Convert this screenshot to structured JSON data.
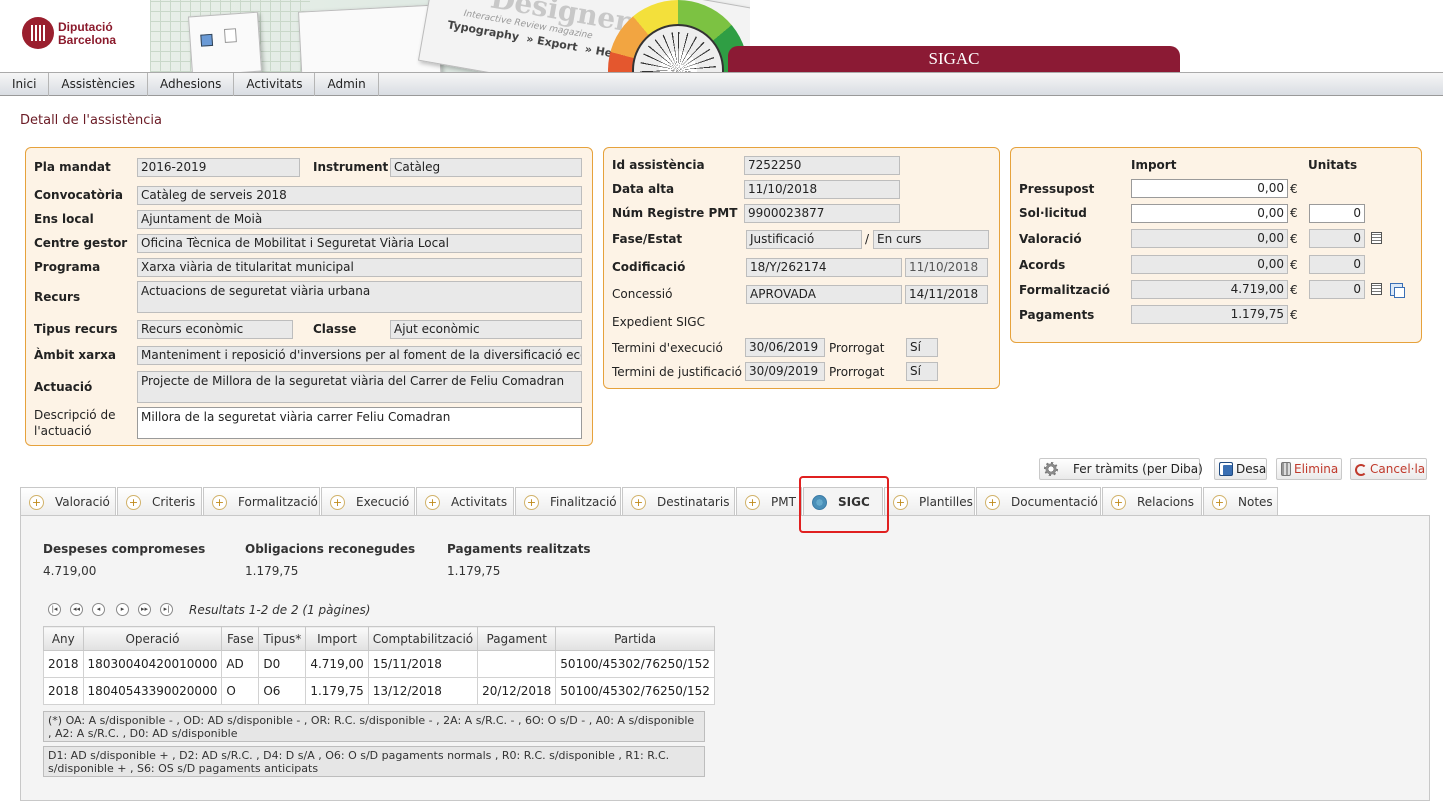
{
  "header": {
    "logo_line1": "Diputació",
    "logo_line2": "Barcelona",
    "banner_word": "Designer",
    "banner_sub": "Interactive Review magazine",
    "banner_menu": [
      "Typography",
      "» Export",
      "» Help"
    ],
    "app_title": "SIGAC"
  },
  "menu": [
    "Inici",
    "Assistències",
    "Adhesions",
    "Activitats",
    "Admin"
  ],
  "page_title": "Detall de l'assistència",
  "left_panel": {
    "pla_mandat_label": "Pla mandat",
    "pla_mandat": "2016-2019",
    "instrument_label": "Instrument",
    "instrument": "Catàleg",
    "convocatoria_label": "Convocatòria",
    "convocatoria": "Catàleg de serveis 2018",
    "ens_local_label": "Ens local",
    "ens_local": "Ajuntament de Moià",
    "centre_gestor_label": "Centre gestor",
    "centre_gestor": "Oficina Tècnica de Mobilitat i Seguretat Viària Local",
    "programa_label": "Programa",
    "programa": "Xarxa viària de titularitat municipal",
    "recurs_label": "Recurs",
    "recurs": "Actuacions de seguretat viària urbana",
    "tipus_recurs_label": "Tipus recurs",
    "tipus_recurs": "Recurs econòmic",
    "classe_label": "Classe",
    "classe": "Ajut econòmic",
    "ambit_label": "Àmbit xarxa",
    "ambit": "Manteniment i reposició d'inversions per al foment de la diversificació econòmica",
    "actuacio_label": "Actuació",
    "actuacio": "Projecte de Millora de la seguretat viària del Carrer de Feliu Comadran",
    "descripcio_label1": "Descripció de",
    "descripcio_label2": "l'actuació",
    "descripcio": "Millora de la seguretat viària carrer Feliu Comadran"
  },
  "mid_panel": {
    "id_label": "Id assistència",
    "id": "7252250",
    "data_alta_label": "Data alta",
    "data_alta": "11/10/2018",
    "num_registre_label": "Núm Registre PMT",
    "num_registre": "9900023877",
    "fase_label": "Fase/Estat",
    "fase": "Justificació",
    "fase_sep": "/",
    "estat": "En curs",
    "codificacio_label": "Codificació",
    "codificacio": "18/Y/262174",
    "codificacio_date": "11/10/2018",
    "concessio_label": "Concessió",
    "concessio": "APROVADA",
    "concessio_date": "14/11/2018",
    "expedient_label": "Expedient SIGC",
    "termini_exec_label": "Termini d'execució",
    "termini_exec": "30/06/2019",
    "termini_just_label": "Termini de justificació",
    "termini_just": "30/09/2019",
    "prorrogat_label": "Prorrogat",
    "prorrogat1": "Sí",
    "prorrogat2": "Sí"
  },
  "right_panel": {
    "import_header": "Import",
    "unitats_header": "Unitats",
    "currency": "€",
    "rows": [
      {
        "label": "Pressupost",
        "import": "0,00",
        "unitats": null
      },
      {
        "label": "Sol·licitud",
        "import": "0,00",
        "unitats": "0"
      },
      {
        "label": "Valoració",
        "import": "0,00",
        "unitats": "0"
      },
      {
        "label": "Acords",
        "import": "0,00",
        "unitats": "0"
      },
      {
        "label": "Formalització",
        "import": "4.719,00",
        "unitats": "0"
      },
      {
        "label": "Pagaments",
        "import": "1.179,75",
        "unitats": null
      }
    ]
  },
  "actions": {
    "tramits": "Fer tràmits (per Diba)",
    "desa": "Desa",
    "elimina": "Elimina",
    "cancela": "Cancel·la"
  },
  "tabs": [
    "Valoració",
    "Criteris",
    "Formalització",
    "Execució",
    "Activitats",
    "Finalització",
    "Destinataris",
    "PMT",
    "SIGC",
    "Plantilles",
    "Documentació",
    "Relacions",
    "Notes"
  ],
  "active_tab": "SIGC",
  "summary": {
    "despeses_label": "Despeses compromeses",
    "despeses": "4.719,00",
    "obligacions_label": "Obligacions reconegudes",
    "obligacions": "1.179,75",
    "pagaments_label": "Pagaments realitzats",
    "pagaments": "1.179,75"
  },
  "pager_text": "Resultats 1-2 de 2 (1 pàgines)",
  "table": {
    "headers": [
      "Any",
      "Operació",
      "Fase",
      "Tipus*",
      "Import",
      "Comptabilització",
      "Pagament",
      "Partida"
    ],
    "rows": [
      [
        "2018",
        "18030040420010000",
        "AD",
        "D0",
        "4.719,00",
        "15/11/2018",
        "",
        "50100/45302/76250/152"
      ],
      [
        "2018",
        "18040543390020000",
        "O",
        "O6",
        "1.179,75",
        "13/12/2018",
        "20/12/2018",
        "50100/45302/76250/152"
      ]
    ]
  },
  "notes": {
    "note1": "(*) OA: A s/disponible - , OD: AD s/disponible - , OR:  R.C. s/disponible - , 2A:  A s/R.C. - , 6O:  O s/D - , A0: A s/disponible , A2: A s/R.C. , D0: AD s/disponible",
    "note2": "D1: AD s/disponible + , D2: AD s/R.C. , D4:  D s/A , O6: O s/D pagaments normals , R0:  R.C. s/disponible , R1:  R.C. s/disponible + , S6:  OS s/D pagaments anticipats"
  },
  "colors": {
    "brand": "#8b1a34",
    "panel_border": "#e6a23c",
    "panel_bg": "#fdf3e6",
    "highlight": "#e02020"
  }
}
